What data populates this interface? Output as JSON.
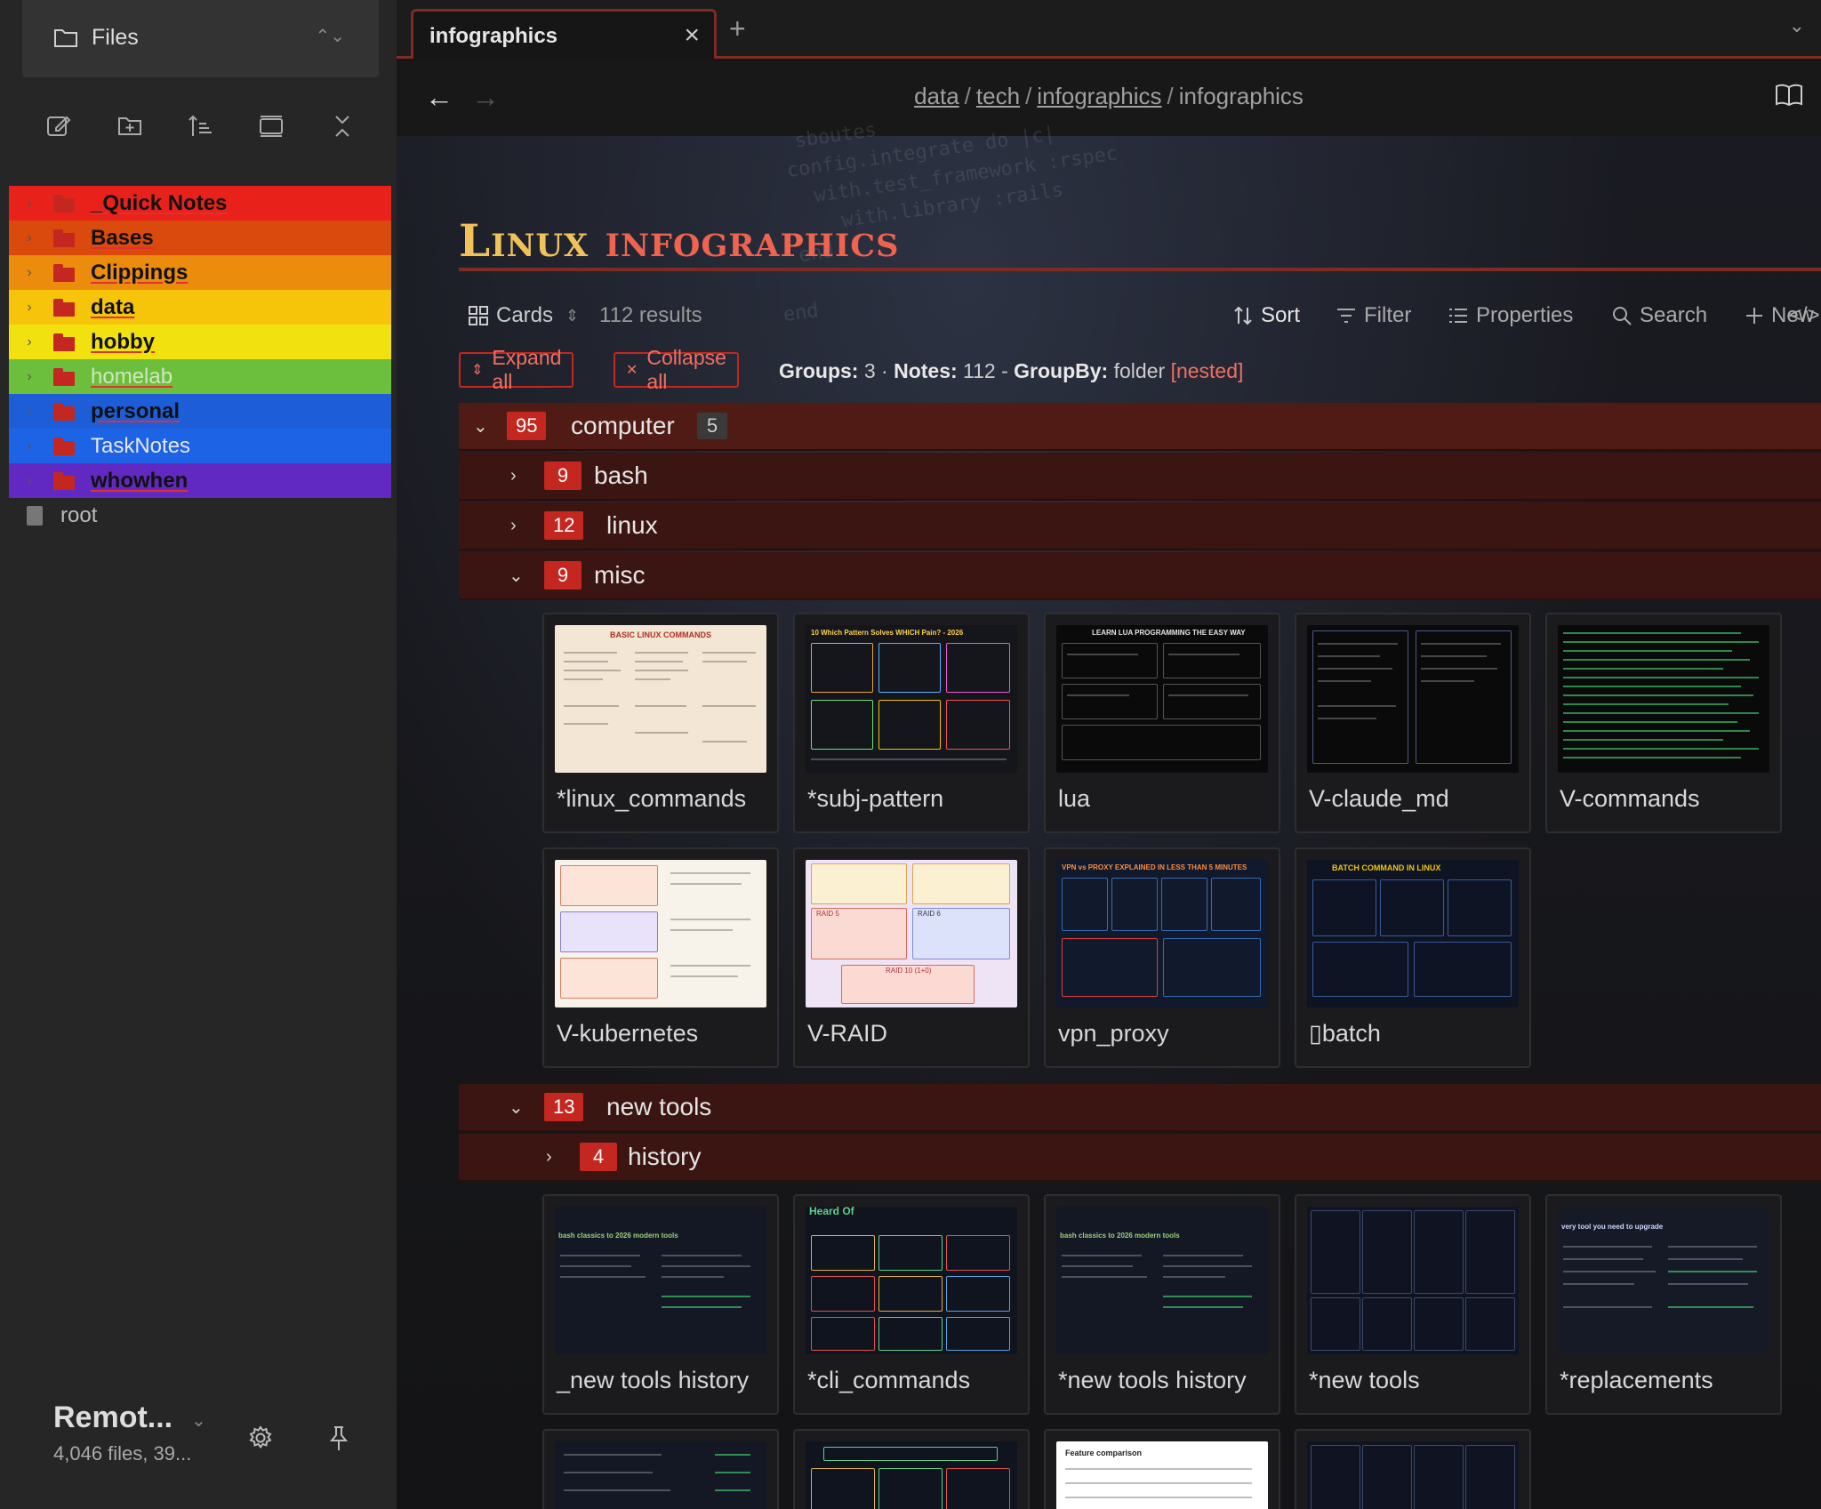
{
  "sidebar": {
    "header_title": "Files",
    "folders": [
      {
        "name": "_Quick Notes",
        "color": "#e8221b"
      },
      {
        "name": "Bases",
        "color": "#d94a0c"
      },
      {
        "name": "Clippings",
        "color": "#eb8c0c"
      },
      {
        "name": "data",
        "color": "#f6c50a"
      },
      {
        "name": "hobby",
        "color": "#f1e20f"
      },
      {
        "name": "homelab",
        "color": "#6cbf3c"
      },
      {
        "name": "personal",
        "color": "#1d5ed8"
      },
      {
        "name": "TaskNotes",
        "color": "#1d63e6"
      },
      {
        "name": "whowhen",
        "color": "#6129c2"
      }
    ],
    "root_file": "root",
    "vault_name": "Remot...",
    "vault_info": "4,046 files, 39..."
  },
  "tab": {
    "title": "infographics"
  },
  "breadcrumb": [
    "data",
    "tech",
    "infographics",
    "infographics"
  ],
  "page": {
    "title_word1": "Linux",
    "title_word2": "infographics"
  },
  "toolbar": {
    "view": "Cards",
    "results": "112 results",
    "sort": "Sort",
    "filter": "Filter",
    "properties": "Properties",
    "search": "Search",
    "new": "New"
  },
  "grouping": {
    "expand_all": "Expand all",
    "collapse_all": "Collapse all",
    "groups_label": "Groups:",
    "groups_value": "3",
    "notes_label": "Notes:",
    "notes_value": "112",
    "groupby_label": "GroupBy:",
    "groupby_value": "folder",
    "nested": "[nested]"
  },
  "groups": {
    "computer": {
      "count": "95",
      "name": "computer",
      "sub": "5"
    },
    "bash": {
      "count": "9",
      "name": "bash"
    },
    "linux": {
      "count": "12",
      "name": "linux"
    },
    "misc": {
      "count": "9",
      "name": "misc"
    },
    "new_tools": {
      "count": "13",
      "name": "new tools"
    },
    "history": {
      "count": "4",
      "name": "history"
    }
  },
  "misc_cards": [
    "*linux_commands",
    "*subj-pattern",
    "lua",
    "V-claude_md",
    "V-commands",
    "V-kubernetes",
    "V-RAID",
    "vpn_proxy",
    "▯batch"
  ],
  "new_tools_cards": [
    "_new tools history",
    "*cli_commands",
    "*new tools history",
    "*new tools",
    "*replacements"
  ],
  "thumb_text": {
    "linux_commands": "BASIC LINUX COMMANDS",
    "subj_pattern": "10 Which Pattern Solves WHICH Pain? - 2026",
    "lua": "LEARN LUA PROGRAMMING THE EASY WAY",
    "raid5": "RAID 5",
    "raid6": "RAID 6",
    "raid10": "RAID 10 (1+0)",
    "vpn": "VPN vs PROXY EXPLAINED IN LESS THAN 5 MINUTES",
    "batch": "BATCH COMMAND IN LINUX",
    "nt_history": "bash classics to 2026 modern tools",
    "cli_top": "Heard Of",
    "replacements": "very tool you need to upgrade",
    "feature": "Feature comparison"
  },
  "colors": {
    "accent": "#c4271f",
    "title_gold": "#f0c35a",
    "title_red": "#f0634f"
  }
}
